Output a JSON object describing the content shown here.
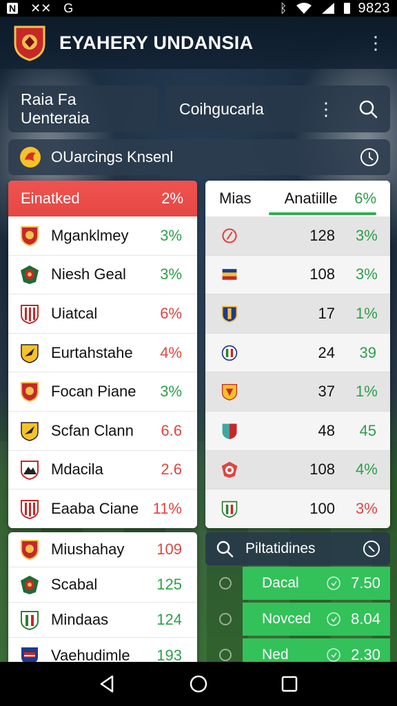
{
  "status_bar": {
    "time": "9823"
  },
  "app_bar": {
    "title": "EYAHERY UNDANSIA"
  },
  "filters": {
    "first": "Raia Fa Uenteraia",
    "second": "Coihgucarla"
  },
  "league": {
    "name": "OUarcings Knsenl"
  },
  "left_panel": {
    "header": {
      "label": "Einatked",
      "pct": "2%"
    },
    "rows": [
      {
        "name": "Mganklmey",
        "value": "3%",
        "color": "green",
        "crest": "crest-red-gold"
      },
      {
        "name": "Niesh Geal",
        "value": "3%",
        "color": "green",
        "crest": "crest-green-red"
      },
      {
        "name": "Uiatcal",
        "value": "6%",
        "color": "red",
        "crest": "crest-red-stripes"
      },
      {
        "name": "Eurtahstahe",
        "value": "4%",
        "color": "red",
        "crest": "crest-yellow-black"
      },
      {
        "name": "Focan Piane",
        "value": "3%",
        "color": "green",
        "crest": "crest-red-gold"
      },
      {
        "name": "Scfan Clann",
        "value": "6.6",
        "color": "red",
        "crest": "crest-yellow-black"
      },
      {
        "name": "Mdacila",
        "value": "2.6",
        "color": "red",
        "crest": "crest-mountain"
      },
      {
        "name": "Eaaba Ciane",
        "value": "11%",
        "color": "red",
        "crest": "crest-red-stripes"
      }
    ]
  },
  "left_panel_2": {
    "rows": [
      {
        "name": "Miushahay",
        "value": "109",
        "color": "red",
        "crest": "crest-red-gold"
      },
      {
        "name": "Scabal",
        "value": "125",
        "color": "green",
        "crest": "crest-green-red"
      },
      {
        "name": "Mindaas",
        "value": "124",
        "color": "green",
        "crest": "crest-green-white"
      },
      {
        "name": "Vaehudimle",
        "value": "193",
        "color": "green",
        "crest": "crest-blue-red"
      }
    ]
  },
  "right_panel": {
    "header": {
      "col1": "Mias",
      "col2": "Anatiille",
      "pct": "6%"
    },
    "rows": [
      {
        "num": "128",
        "value": "3%",
        "color": "green",
        "crest": "crest-red-ring"
      },
      {
        "num": "108",
        "value": "3%",
        "color": "green",
        "crest": "crest-blue-yellow"
      },
      {
        "num": "17",
        "value": "1%",
        "color": "green",
        "crest": "crest-blue-gold"
      },
      {
        "num": "24",
        "value": "39",
        "color": "green",
        "crest": "crest-green-red-white"
      },
      {
        "num": "37",
        "value": "1%",
        "color": "green",
        "crest": "crest-yellow-red"
      },
      {
        "num": "48",
        "value": "45",
        "color": "green",
        "crest": "crest-teal-red"
      },
      {
        "num": "108",
        "value": "4%",
        "color": "green",
        "crest": "crest-red-cs"
      },
      {
        "num": "100",
        "value": "3%",
        "color": "red",
        "crest": "crest-green-white"
      }
    ]
  },
  "predictions": {
    "header": "Piltatidines",
    "items": [
      {
        "name": "Dacal",
        "odd": "7.50"
      },
      {
        "name": "Novced",
        "odd": "8.04"
      },
      {
        "name": "Ned",
        "odd": "2.30"
      }
    ]
  },
  "colors": {
    "accent_red": "#ef5350",
    "accent_green": "#33c15a",
    "positive": "#2e9e48",
    "negative": "#e0453f"
  }
}
